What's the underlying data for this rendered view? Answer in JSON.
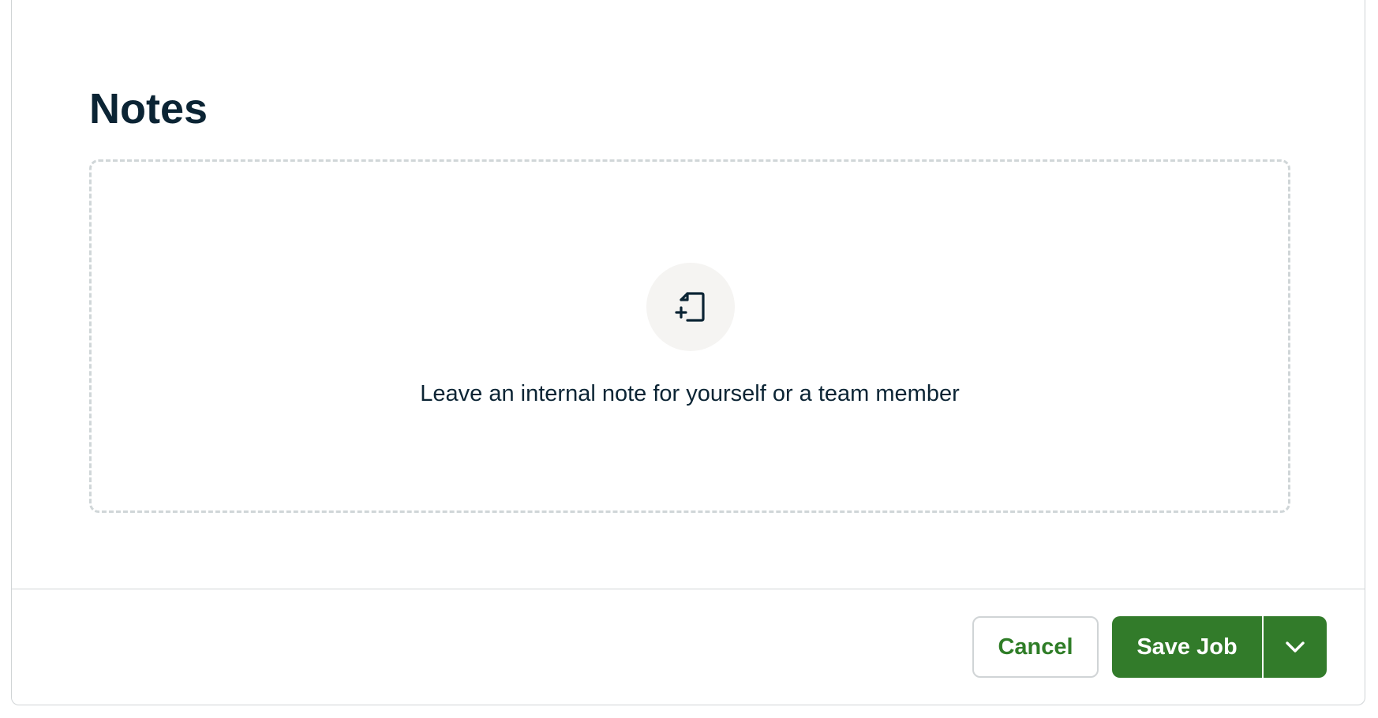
{
  "notes": {
    "title": "Notes",
    "empty_message": "Leave an internal note for yourself or a team member",
    "icon": "file-add-icon"
  },
  "footer": {
    "cancel_label": "Cancel",
    "save_label": "Save Job",
    "more_icon": "chevron-down-icon"
  },
  "colors": {
    "primary_green": "#327b2a",
    "text_dark": "#0b2434",
    "border": "#d0d4d6"
  }
}
